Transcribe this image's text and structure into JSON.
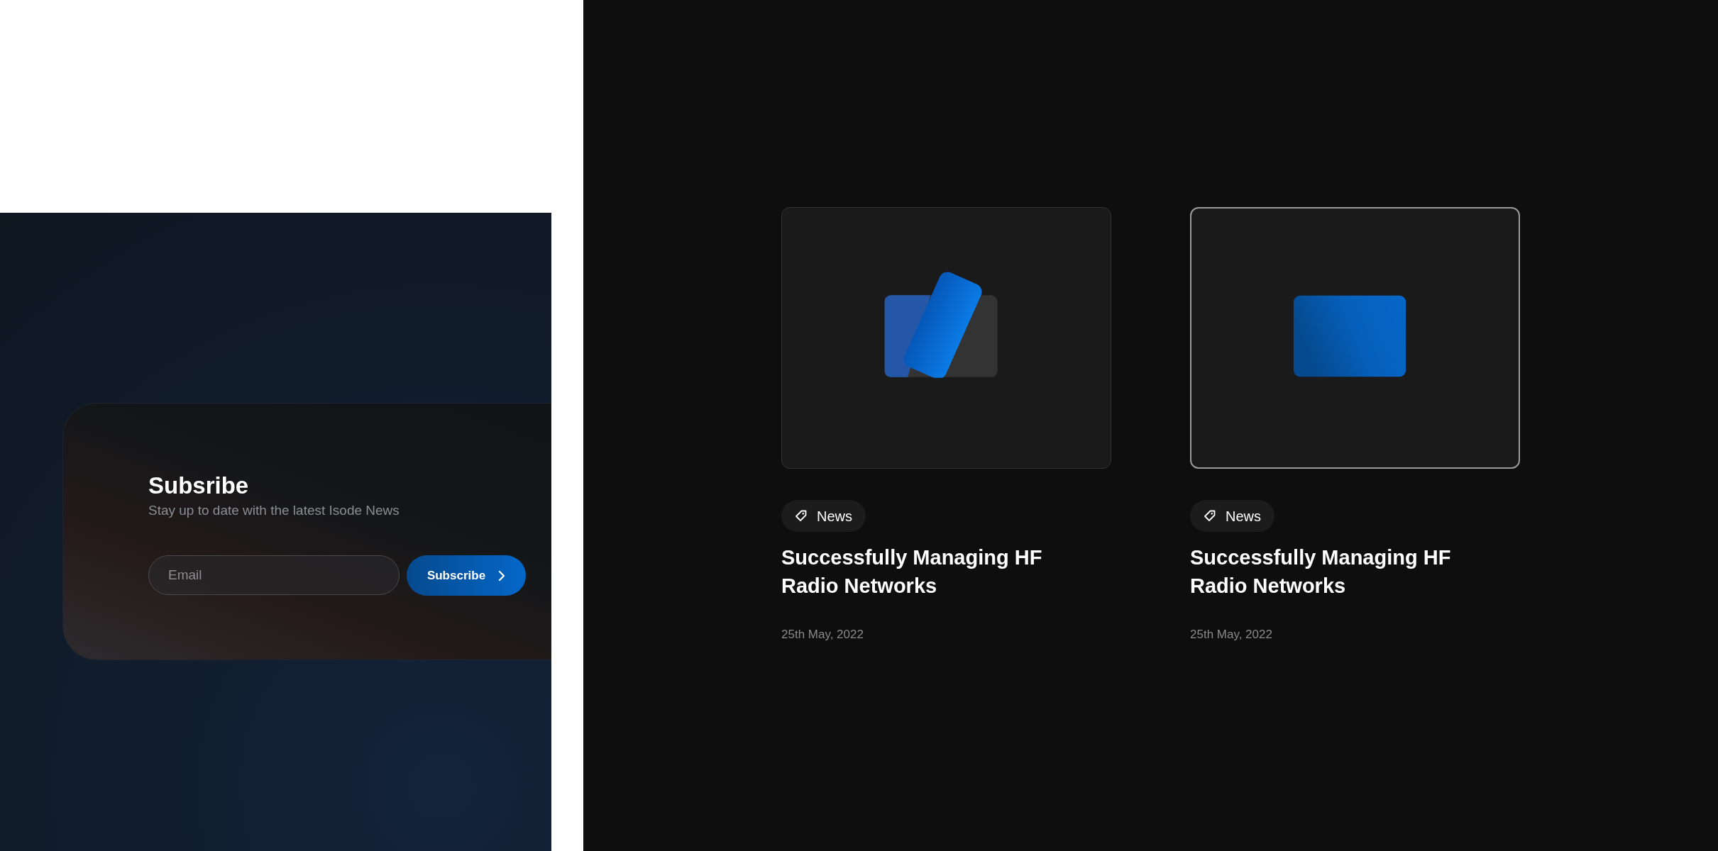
{
  "subscribe": {
    "title": "Subsribe",
    "subtitle": "Stay up to date with the latest Isode News",
    "email": {
      "placeholder": "Email"
    },
    "button": "Subscribe"
  },
  "articles": [
    {
      "kind": "stacked",
      "selected": false,
      "tag": "News",
      "title": "Successfully Managing HF Radio Networks",
      "date": "25th May, 2022"
    },
    {
      "kind": "single",
      "selected": true,
      "tag": "News",
      "title": "Successfully Managing HF Radio Networks",
      "date": "25th May, 2022"
    }
  ]
}
